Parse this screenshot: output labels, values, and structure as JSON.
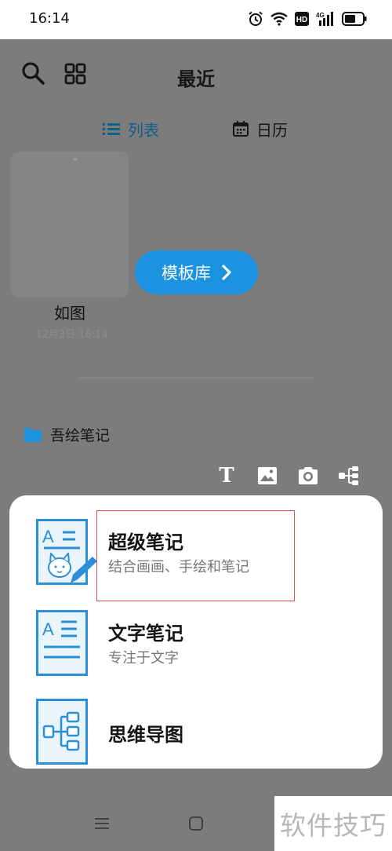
{
  "status_bar": {
    "time": "16:14",
    "icons": [
      "alarm-icon",
      "wifi-icon",
      "hd-icon",
      "4g-signal-icon",
      "battery-icon"
    ]
  },
  "header": {
    "title": "最近",
    "icons": [
      "search-icon",
      "grid-icon"
    ]
  },
  "view_tabs": {
    "list_label": "列表",
    "calendar_label": "日历",
    "active": "list"
  },
  "note": {
    "title": "如图",
    "date": "12月3日 16:14"
  },
  "template_button": {
    "label": "模板库"
  },
  "folder": {
    "name": "吾绘笔记"
  },
  "tools": [
    "text-tool-icon",
    "image-tool-icon",
    "camera-tool-icon",
    "mindmap-tool-icon"
  ],
  "sheet": {
    "items": [
      {
        "title": "超级笔记",
        "subtitle": "结合画画、手绘和笔记",
        "icon": "super-note-icon"
      },
      {
        "title": "文字笔记",
        "subtitle": "专注于文字",
        "icon": "text-note-icon"
      },
      {
        "title": "思维导图",
        "icon": "mindmap-icon"
      }
    ]
  },
  "watermark": "软件技巧",
  "colors": {
    "accent": "#1c93e0",
    "overlay": "#7c7c7c",
    "highlight": "#d9534f",
    "icon_blue": "#2a8fd6"
  }
}
